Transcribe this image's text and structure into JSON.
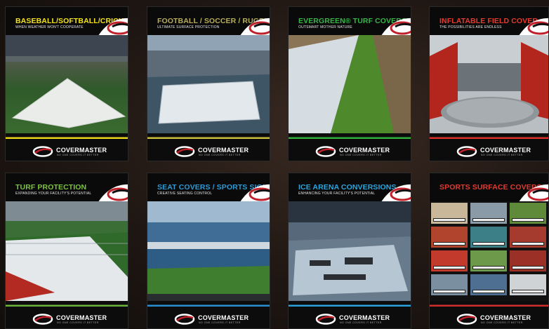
{
  "logo": {
    "name": "COVERMASTER",
    "tagline": "NO ONE COVERS IT BETTER"
  },
  "brochures": [
    {
      "title": "BASEBALL/SOFTBALL/CRICKET",
      "subtitle": "WHEN WEATHER WON'T COOPERATE",
      "title_color": "#f4e31a",
      "accent": "#e8d21a"
    },
    {
      "title": "FOOTBALL / SOCCER / RUGBY",
      "subtitle": "ULTIMATE SURFACE PROTECTION",
      "title_color": "#b7ad5a",
      "accent": "#c9bd3c"
    },
    {
      "title": "EVERGREEN® TURF COVERS",
      "subtitle": "OUTSMART MOTHER NATURE",
      "title_color": "#38b449",
      "accent": "#2fae3c"
    },
    {
      "title": "INFLATABLE FIELD COVER",
      "subtitle": "THE POSSIBILITIES ARE ENDLESS",
      "title_color": "#e83a2e",
      "accent": "#d9302a"
    },
    {
      "title": "TURF PROTECTION",
      "subtitle": "EXPANDING YOUR FACILITY'S POTENTIAL",
      "title_color": "#7dc242",
      "accent": "#6bb33a"
    },
    {
      "title": "SEAT COVERS / SPORTS SIGNAGE",
      "subtitle": "CREATIVE SEATING CONTROL",
      "title_color": "#2e9ad6",
      "accent": "#2a8fd0"
    },
    {
      "title": "ICE ARENA CONVERSIONS",
      "subtitle": "ENHANCING YOUR FACILITY'S POTENTIAL",
      "title_color": "#2aa6df",
      "accent": "#2aa0dc"
    },
    {
      "title": "SPORTS SURFACE COVERS",
      "subtitle": "",
      "title_color": "#e23a31",
      "accent": "#cf2f2a"
    }
  ]
}
